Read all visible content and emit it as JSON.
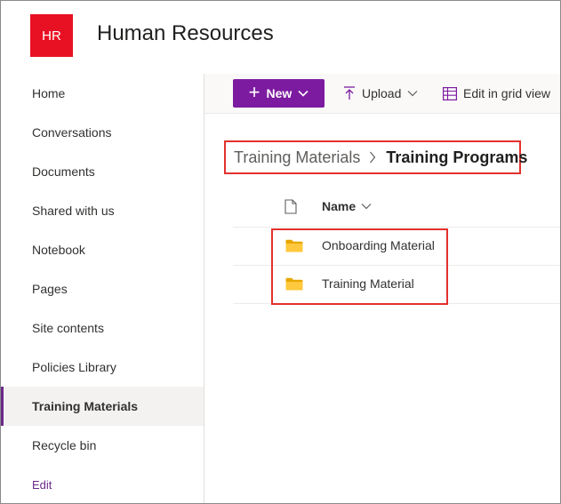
{
  "site": {
    "logo_text": "HR",
    "title": "Human Resources",
    "logo_color": "#e81123"
  },
  "nav": {
    "items": [
      {
        "label": "Home"
      },
      {
        "label": "Conversations"
      },
      {
        "label": "Documents"
      },
      {
        "label": "Shared with us"
      },
      {
        "label": "Notebook"
      },
      {
        "label": "Pages"
      },
      {
        "label": "Site contents"
      },
      {
        "label": "Policies Library"
      },
      {
        "label": "Training Materials",
        "selected": true
      },
      {
        "label": "Recycle bin"
      }
    ],
    "edit_label": "Edit",
    "accent_color": "#6b2a8a"
  },
  "command_bar": {
    "new_label": "New",
    "upload_label": "Upload",
    "grid_label": "Edit in grid view",
    "new_color": "#7c1ba0"
  },
  "breadcrumb": {
    "root": "Training Materials",
    "current": "Training Programs"
  },
  "list": {
    "name_header": "Name",
    "rows": [
      {
        "name": "Onboarding Material",
        "type": "folder"
      },
      {
        "name": "Training Material",
        "type": "folder"
      }
    ]
  },
  "icons": {
    "new": "plus-icon",
    "new_chevron": "chevron-down-icon",
    "upload": "upload-icon",
    "grid": "grid-view-icon",
    "breadcrumb_separator": "chevron-right-icon",
    "file_type": "document-icon",
    "folder": "folder-icon"
  },
  "highlight_color": "#e3312d"
}
